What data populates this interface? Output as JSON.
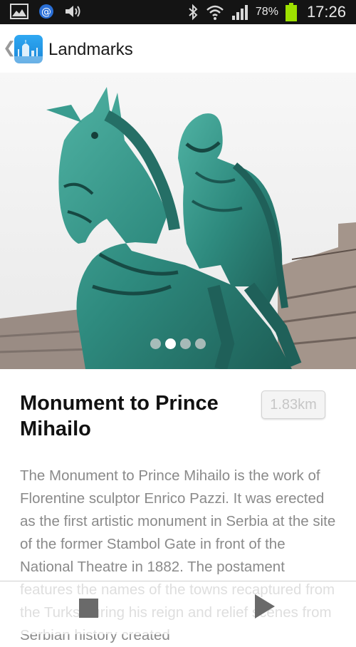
{
  "status_bar": {
    "battery_percent": "78%",
    "time": "17:26",
    "icons": [
      "gallery-icon",
      "at-icon",
      "volume-icon",
      "bluetooth-icon",
      "wifi-icon",
      "signal-icon",
      "battery-icon"
    ]
  },
  "app_bar": {
    "title": "Landmarks",
    "logo_icon": "city-skyline-logo"
  },
  "gallery": {
    "image_count": 4,
    "active_index": 1
  },
  "place": {
    "title": "Monument to Prince Mihailo",
    "distance": "1.83km",
    "description": "The Monument to Prince Mihailo is the work of Florentine sculptor Enrico Pazzi. It was erected as the first artistic monument in Serbia at the site of the former Stambol Gate in front of the National Theatre in 1882. The postament features the names of the towns recaptured from the Turks during his reign and relief scenes from Serbian history created"
  },
  "player": {
    "stop_icon": "stop-icon",
    "play_icon": "play-icon"
  },
  "colors": {
    "status_bar_bg": "#141414",
    "battery": "#9de000",
    "logo": "#2298ea",
    "statue_patina": "#2e8a7e"
  }
}
